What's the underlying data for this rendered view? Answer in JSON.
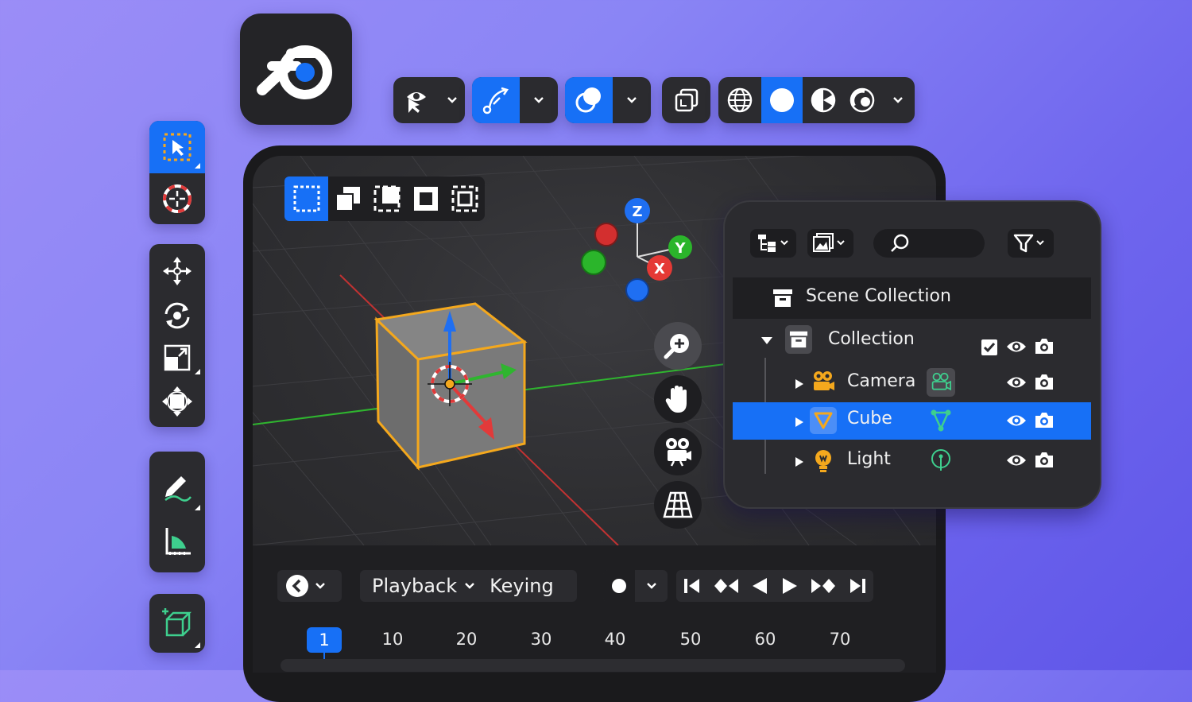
{
  "app": {
    "logo_icon": "blender-logo-icon"
  },
  "colors": {
    "accent": "#1770f6",
    "panel": "#2b2b2f",
    "background_start": "#9b8df7",
    "background_end": "#5f56e8",
    "selection_outline": "#f4a81d"
  },
  "top_toolbar": {
    "groups": [
      {
        "name": "view-select",
        "icons": [
          "eye-pointer-icon",
          "chevron-down-icon"
        ]
      },
      {
        "name": "transform-pivot",
        "icons": [
          "curve-arrow-icon",
          "chevron-down-icon"
        ],
        "active": true
      },
      {
        "name": "overlays",
        "icons": [
          "overlay-circles-icon",
          "chevron-down-icon"
        ],
        "active": true
      },
      {
        "name": "xray",
        "icons": [
          "xray-icon"
        ]
      },
      {
        "name": "shading",
        "icons": [
          "wireframe-sphere-icon",
          "solid-sphere-icon",
          "material-sphere-icon",
          "rendered-sphere-icon",
          "chevron-down-icon"
        ],
        "active_index": 1
      }
    ]
  },
  "left_toolbar": {
    "groups": [
      [
        "select-box-icon",
        "cursor-icon"
      ],
      [
        "move-icon",
        "rotate-icon",
        "scale-icon",
        "transform-icon"
      ],
      [
        "annotate-icon",
        "measure-icon"
      ],
      [
        "add-cube-icon"
      ]
    ]
  },
  "viewport": {
    "selection_modes": [
      "select-new-icon",
      "select-extend-icon",
      "select-subtract-icon",
      "select-invert-icon",
      "select-intersect-icon"
    ],
    "gizmo": {
      "z": "Z",
      "y": "Y",
      "x": "X"
    },
    "nav_buttons": [
      "zoom-icon",
      "hand-pan-icon",
      "camera-view-icon",
      "perspective-grid-icon"
    ]
  },
  "timeline": {
    "playback_label": "Playback",
    "keying_label": "Keying",
    "transport_icons": [
      "jump-start-icon",
      "prev-keyframe-icon",
      "play-reverse-icon",
      "play-icon",
      "next-keyframe-icon",
      "jump-end-icon"
    ],
    "current_frame": "1",
    "frames": [
      "10",
      "20",
      "30",
      "40",
      "50",
      "60",
      "70"
    ]
  },
  "outliner": {
    "header_icons": [
      "display-mode-icon",
      "filter-image-icon",
      "search-icon",
      "filter-icon"
    ],
    "scene_collection": "Scene Collection",
    "collection": "Collection",
    "items": [
      {
        "label": "Camera",
        "icon": "camera-object-icon",
        "data_icon": "camera-data-icon",
        "selected": false
      },
      {
        "label": "Cube",
        "icon": "mesh-object-icon",
        "data_icon": "mesh-data-icon",
        "selected": true
      },
      {
        "label": "Light",
        "icon": "light-object-icon",
        "data_icon": "light-data-icon",
        "selected": false
      }
    ]
  }
}
